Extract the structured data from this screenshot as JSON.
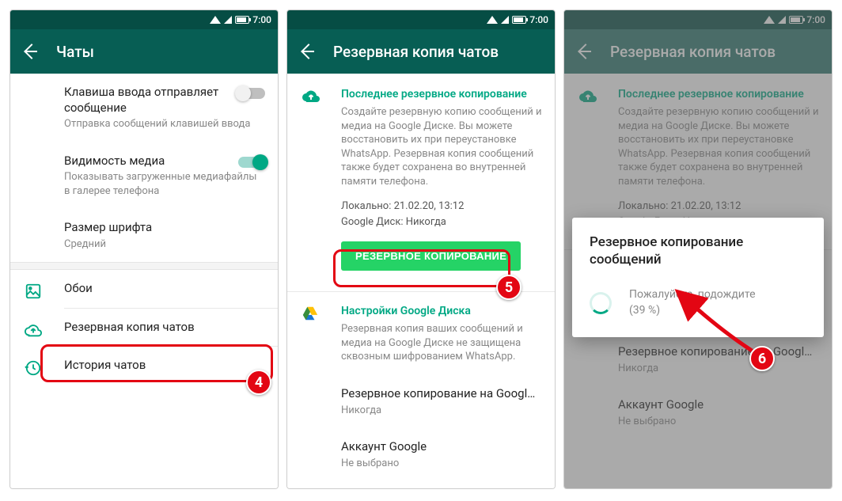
{
  "status": {
    "time": "7:00"
  },
  "screen1": {
    "title": "Чаты",
    "enterSend": {
      "title": "Клавиша ввода отправляет сообщение",
      "sub": "Отправка сообщений клавишей ввода"
    },
    "media": {
      "title": "Видимость медиа",
      "sub": "Показывать загруженные медиафайлы в галерее телефона"
    },
    "fontSize": {
      "title": "Размер шрифта",
      "value": "Средний"
    },
    "wallpaper": "Обои",
    "backup": "Резервная копия чатов",
    "history": "История чатов",
    "badge": "4"
  },
  "screen2": {
    "title": "Резервная копия чатов",
    "lastBackup": {
      "head": "Последнее резервное копирование",
      "desc": "Создайте резервную копию сообщений и медиа на Google Диске. Вы можете восстановить их при переустановке WhatsApp. Резервная копия сообщений также будет сохранена во внутренней памяти телефона.",
      "local": "Локально: 21.02.20, 13:12",
      "gdrive": "Google Диск: Никогда",
      "button": "РЕЗЕРВНОЕ КОПИРОВАНИЕ"
    },
    "gdrive": {
      "head": "Настройки Google Диска",
      "desc": "Резервная копия ваших сообщений и медиа на Google Диске не защищена сквозным шифрованием WhatsApp.",
      "freq": {
        "title": "Резервное копирование на Googl…",
        "value": "Никогда"
      },
      "account": {
        "title": "Аккаунт Google",
        "value": "Не выбрано"
      }
    },
    "badge": "5"
  },
  "screen3": {
    "dialog": {
      "title": "Резервное копирование сообщений",
      "wait": "Пожалуйста, подождите",
      "pct": "(39 %)"
    },
    "badge": "6"
  }
}
